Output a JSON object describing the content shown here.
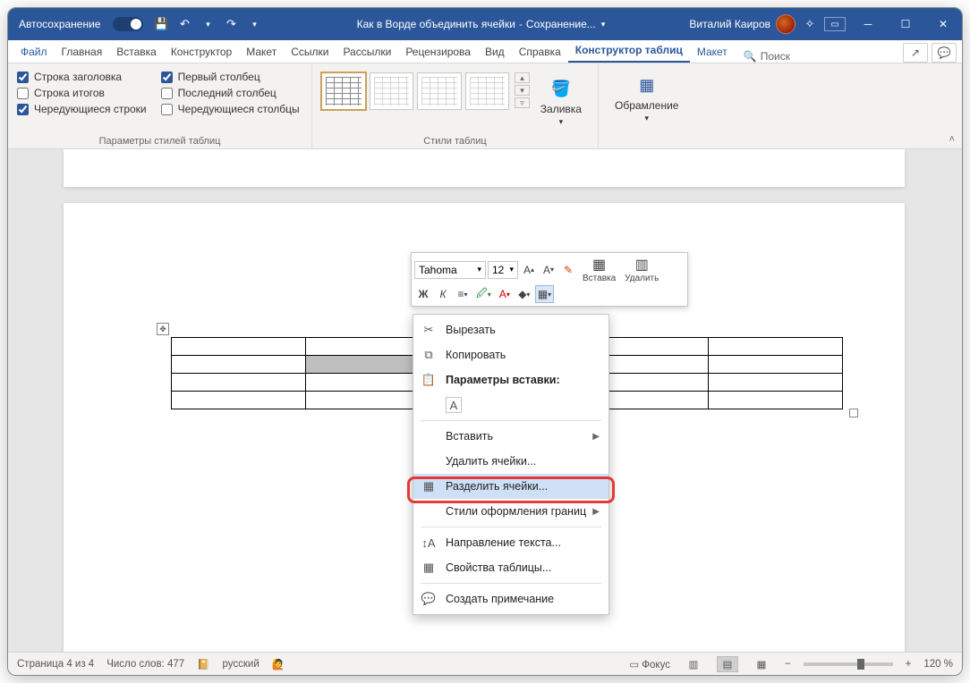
{
  "titlebar": {
    "autosave": "Автосохранение",
    "doc_name": "Как в Ворде объединить ячейки",
    "saving": "Сохранение...",
    "user": "Виталий Каиров"
  },
  "tabs": {
    "file": "Файл",
    "home": "Главная",
    "insert": "Вставка",
    "design": "Конструктор",
    "layout": "Макет",
    "references": "Ссылки",
    "mailings": "Рассылки",
    "review": "Рецензирова",
    "view": "Вид",
    "help": "Справка",
    "table_design": "Конструктор таблиц",
    "table_layout": "Макет",
    "search": "Поиск"
  },
  "ribbon": {
    "opts": {
      "header_row": "Строка заголовка",
      "total_row": "Строка итогов",
      "banded_rows": "Чередующиеся строки",
      "first_col": "Первый столбец",
      "last_col": "Последний столбец",
      "banded_cols": "Чередующиеся столбцы",
      "group_label": "Параметры стилей таблиц"
    },
    "styles_label": "Стили таблиц",
    "shading": "Заливка",
    "borders": "Обрамление"
  },
  "mini_toolbar": {
    "font": "Tahoma",
    "size": "12",
    "insert": "Вставка",
    "delete": "Удалить",
    "bold": "Ж",
    "italic": "К"
  },
  "context_menu": {
    "cut": "Вырезать",
    "copy": "Копировать",
    "paste_options": "Параметры вставки:",
    "insert": "Вставить",
    "delete_cells": "Удалить ячейки...",
    "split_cells": "Разделить ячейки...",
    "border_styles": "Стили оформления границ",
    "text_direction": "Направление текста...",
    "table_properties": "Свойства таблицы...",
    "new_comment": "Создать примечание"
  },
  "statusbar": {
    "page": "Страница 4 из 4",
    "words": "Число слов: 477",
    "lang": "русский",
    "focus": "Фокус",
    "zoom": "120 %"
  }
}
